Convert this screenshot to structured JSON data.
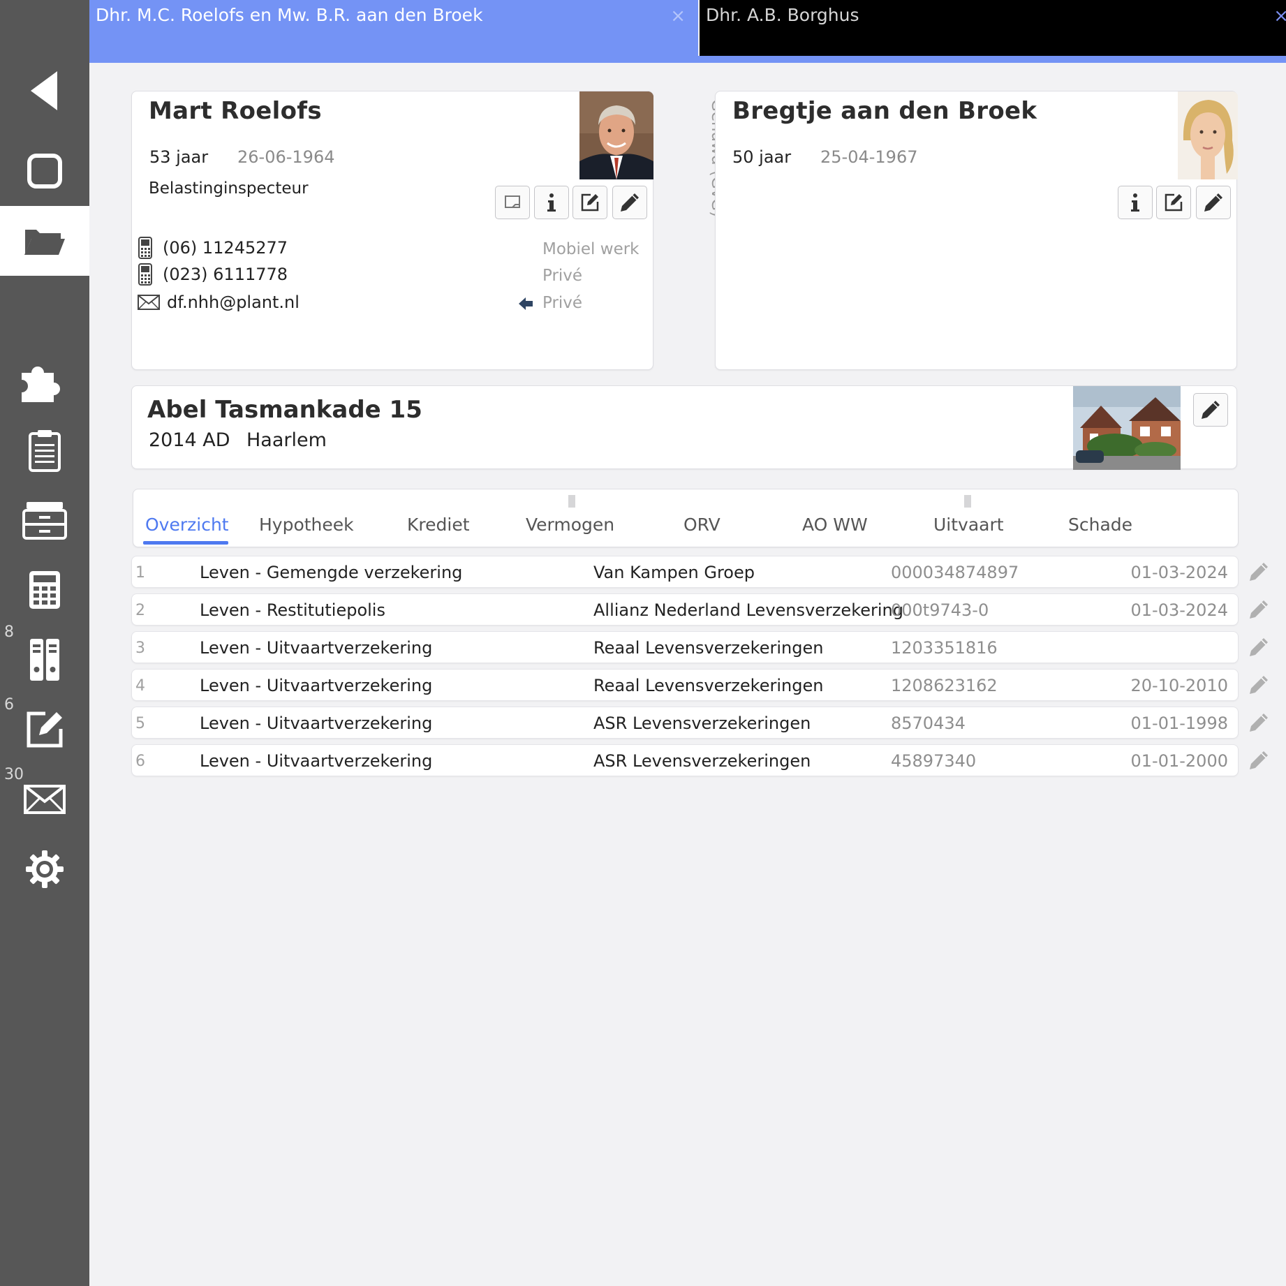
{
  "tabs": [
    {
      "label": "Dhr. M.C. Roelofs en Mw. B.R. aan den Broek",
      "close": "×"
    },
    {
      "label": "Dhr. A.B. Borghus",
      "close": "×"
    }
  ],
  "sidebar": {
    "items": [
      {
        "icon": "back-triangle-icon"
      },
      {
        "icon": "square-icon"
      },
      {
        "icon": "folder-icon",
        "active": true
      },
      {
        "icon": "puzzle-icon"
      },
      {
        "icon": "clipboard-icon"
      },
      {
        "icon": "cabinet-icon"
      },
      {
        "icon": "calculator-icon"
      },
      {
        "icon": "binders-icon",
        "badge": "8"
      },
      {
        "icon": "edit-icon",
        "badge": "6"
      },
      {
        "icon": "mail-icon",
        "badge": "30"
      },
      {
        "icon": "gear-icon"
      }
    ]
  },
  "person1": {
    "name": "Mart Roelofs",
    "age": "53 jaar",
    "dob": "26-06-1964",
    "job": "Belastinginspecteur",
    "contacts": [
      {
        "type": "phone",
        "value": "(06) 11245277",
        "label": "Mobiel werk"
      },
      {
        "type": "phone",
        "value": "(023) 6111778",
        "label": "Privé"
      },
      {
        "type": "email",
        "value": "df.nhh@plant.nl",
        "label": "Privé"
      }
    ]
  },
  "relation": "Gehuwd (GvG)",
  "person2": {
    "name": "Bregtje aan den Broek",
    "age": "50 jaar",
    "dob": "25-04-1967"
  },
  "address": {
    "street": "Abel Tasmankade 15",
    "zip": "2014 AD",
    "city": "Haarlem"
  },
  "product_tabs": [
    "Overzicht",
    "Hypotheek",
    "Krediet",
    "Vermogen",
    "ORV",
    "AO WW",
    "Uitvaart",
    "Schade"
  ],
  "active_product_tab": "Overzicht",
  "policies": [
    {
      "num": "1",
      "type": "Leven - Gemengde verzekering",
      "company": "Van Kampen Groep",
      "policy": "000034874897",
      "date": "01-03-2024"
    },
    {
      "num": "2",
      "type": "Leven - Restitutiepolis",
      "company": "Allianz Nederland Levensverzekering",
      "policy": "000t9743-0",
      "date": "01-03-2024"
    },
    {
      "num": "3",
      "type": "Leven - Uitvaartverzekering",
      "company": "Reaal Levensverzekeringen",
      "policy": "1203351816",
      "date": ""
    },
    {
      "num": "4",
      "type": "Leven - Uitvaartverzekering",
      "company": "Reaal Levensverzekeringen",
      "policy": "1208623162",
      "date": "20-10-2010"
    },
    {
      "num": "5",
      "type": "Leven - Uitvaartverzekering",
      "company": "ASR Levensverzekeringen",
      "policy": "8570434",
      "date": "01-01-1998"
    },
    {
      "num": "6",
      "type": "Leven - Uitvaartverzekering",
      "company": "ASR Levensverzekeringen",
      "policy": "45897340",
      "date": "01-01-2000"
    }
  ],
  "colors": {
    "accent": "#7493f5",
    "link": "#4e79f0",
    "sidebar": "#575757"
  }
}
